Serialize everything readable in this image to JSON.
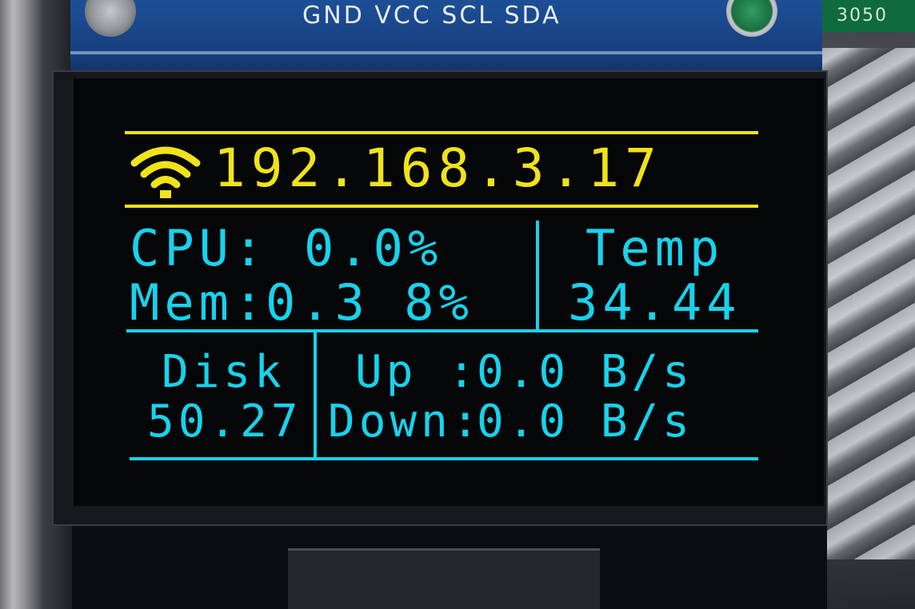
{
  "board": {
    "pin_labels": "GND VCC SCL SDA",
    "chip_marking": "3050"
  },
  "display": {
    "colors": {
      "header": "#f0e21b",
      "body": "#18d2ec",
      "background": "#050608"
    },
    "network": {
      "icon": "wifi-icon",
      "ip_address": "192.168.3.17"
    },
    "cpu": {
      "label": "CPU:",
      "value": "0.0%"
    },
    "mem": {
      "label": "Mem:",
      "value": "0.3 8%"
    },
    "temp": {
      "label": "Temp",
      "value": "34.44"
    },
    "disk": {
      "label": "Disk",
      "value": "50.27"
    },
    "up": {
      "label": "Up :",
      "value": "0.0 B/s"
    },
    "down": {
      "label": "Down:",
      "value": "0.0 B/s"
    }
  }
}
